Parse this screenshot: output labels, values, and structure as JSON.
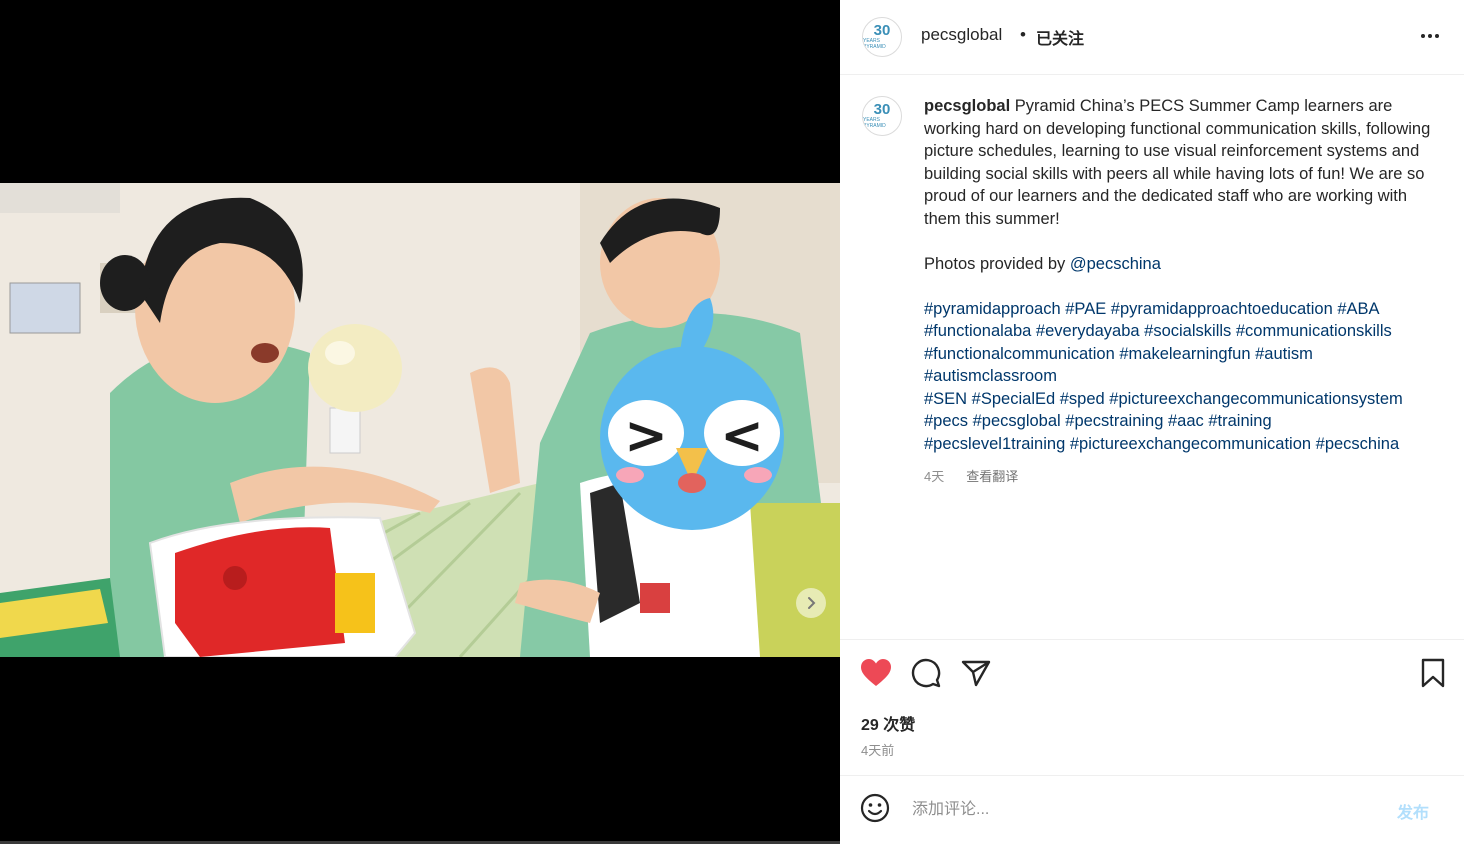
{
  "colors": {
    "like": "#ed4956",
    "link": "#00376b",
    "post_button": "#b2dffc",
    "text": "#262626",
    "muted": "#8e8e8e"
  },
  "media": {
    "next_icon": "chevron-right-icon"
  },
  "header": {
    "avatar_number": "30",
    "avatar_subtext": "YEARS PYRAMID",
    "username": "pecsglobal",
    "separator": "•",
    "follow_status": "已关注",
    "more_icon": "more-horizontal-icon"
  },
  "caption": {
    "username": "pecsglobal",
    "text": "Pyramid China’s PECS Summer Camp learners are working hard on developing functional communication skills, following picture schedules, learning to use visual reinforcement systems and building social skills with peers all while having lots of fun! We are so proud of our learners and the dedicated staff who are working with them this summer!",
    "credit_prefix": "Photos provided by",
    "credit_mention": "@pecschina",
    "hashtag_lines": [
      "#pyramidapproach #PAE #pyramidapproachtoeducation #ABA",
      "#functionalaba #everydayaba #socialskills #communicationskills",
      "#functionalcommunication #makelearningfun #autism",
      "#autismclassroom",
      "#SEN #SpecialEd #sped #pictureexchangecommunicationsystem",
      "#pecs #pecsglobal #pecstraining #aac #training",
      "#pecslevel1training #pictureexchangecommunication #pecschina"
    ],
    "time": "4天",
    "translate": "查看翻译"
  },
  "actions": {
    "like_icon": "heart-filled-icon",
    "comment_icon": "comment-icon",
    "share_icon": "send-icon",
    "save_icon": "bookmark-icon",
    "likes_text": "29 次赞",
    "posted_ago": "4天前"
  },
  "comment": {
    "emoji_icon": "emoji-icon",
    "placeholder": "添加评论...",
    "post_label": "发布"
  }
}
